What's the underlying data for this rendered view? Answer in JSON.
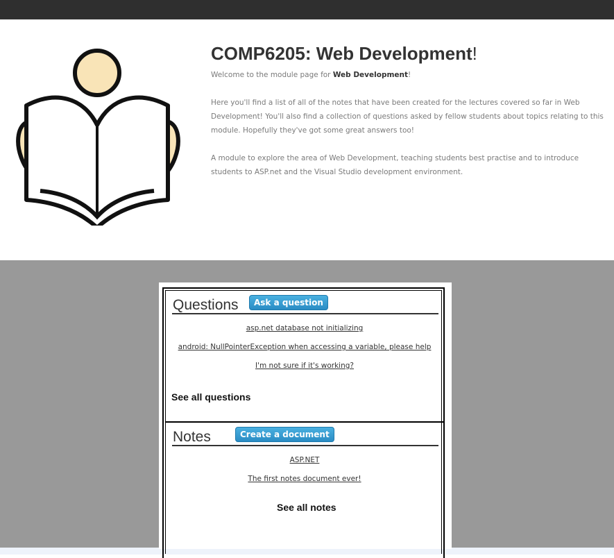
{
  "hero": {
    "title_main": "COMP6205: Web Development",
    "title_bang": "!",
    "intro_prefix": "Welcome to the module page for ",
    "intro_bold": "Web Development",
    "intro_suffix": "!",
    "paragraph1": "Here you'll find a list of all of the notes that have been created for the lectures covered so far in Web Development! You'll also find a collection of questions asked by fellow students about topics relating to this module. Hopefully they've got some great answers too!",
    "paragraph2": "A module to explore the area of Web Development, teaching students best practise and to introduce students to ASP.net and the Visual Studio development environment.",
    "illustration_icon": "reading-person-icon"
  },
  "questions": {
    "title": "Questions",
    "button_label": "Ask a question",
    "items": [
      "asp.net database not initializing",
      "android: NullPointerException when accessing a variable, please help",
      "I'm not sure if it's working?"
    ],
    "see_all": "See all questions"
  },
  "notes": {
    "title": "Notes",
    "button_label": "Create a document",
    "items": [
      "ASP.NET",
      "The first notes document ever!"
    ],
    "see_all": "See all notes"
  },
  "colors": {
    "topbar": "#2f2f2f",
    "panel_background": "#999999",
    "button": "#2a8cc4",
    "illustration_fill": "#f9e4b7"
  }
}
